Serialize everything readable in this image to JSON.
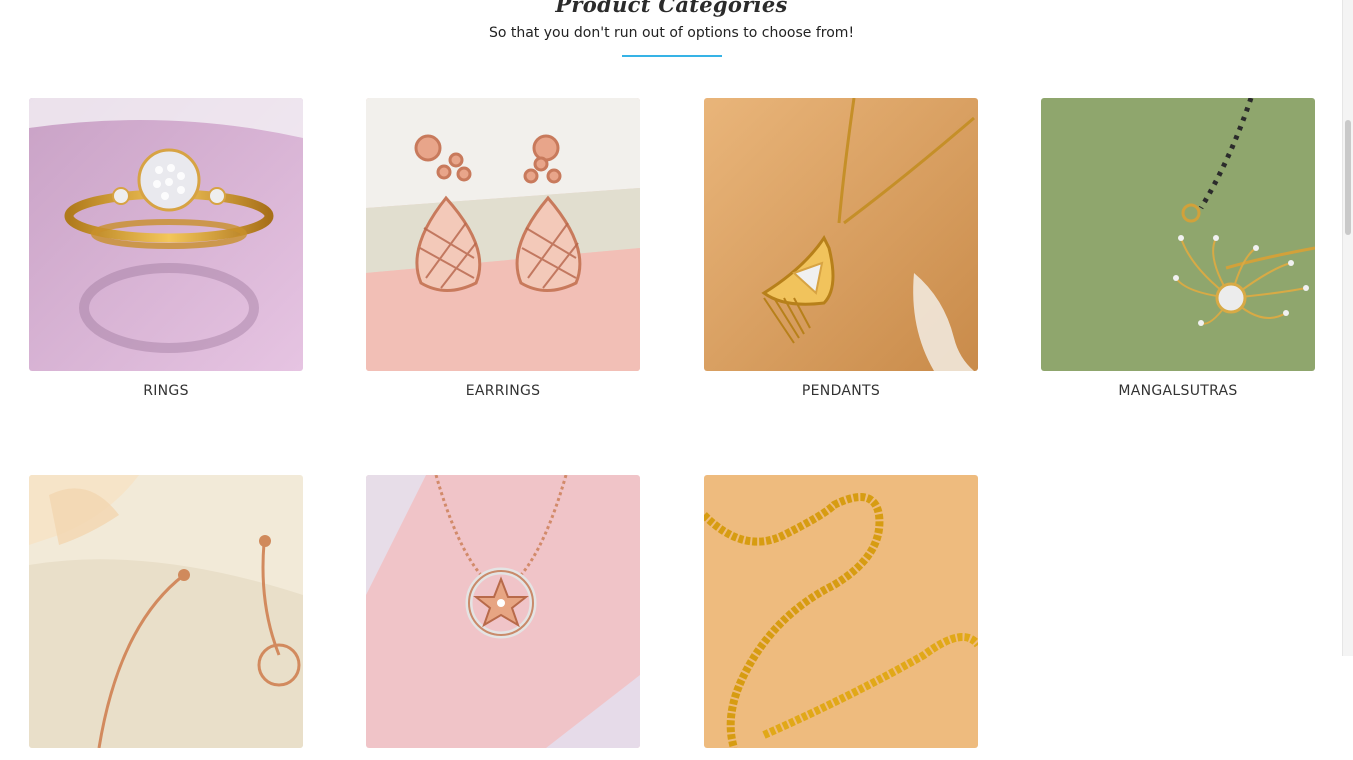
{
  "section": {
    "title": "Product Categories",
    "subtitle": "So that you don't run out of options to choose from!",
    "accent_color": "#36b3e6"
  },
  "categories": [
    {
      "label": "RINGS",
      "image_icon": "ring-image",
      "bg": "#d8b4d6"
    },
    {
      "label": "EARRINGS",
      "image_icon": "earrings-image",
      "bg": "#f2c6bf"
    },
    {
      "label": "PENDANTS",
      "image_icon": "pendant-image",
      "bg": "#d9a265"
    },
    {
      "label": "MANGALSUTRAS",
      "image_icon": "mangalsutra-image",
      "bg": "#8fa66d"
    },
    {
      "label": "",
      "image_icon": "bracelet-image",
      "bg": "#efe6d2"
    },
    {
      "label": "",
      "image_icon": "necklace-image",
      "bg": "#f0c4c8"
    },
    {
      "label": "",
      "image_icon": "chain-image",
      "bg": "#eebb7e"
    }
  ]
}
